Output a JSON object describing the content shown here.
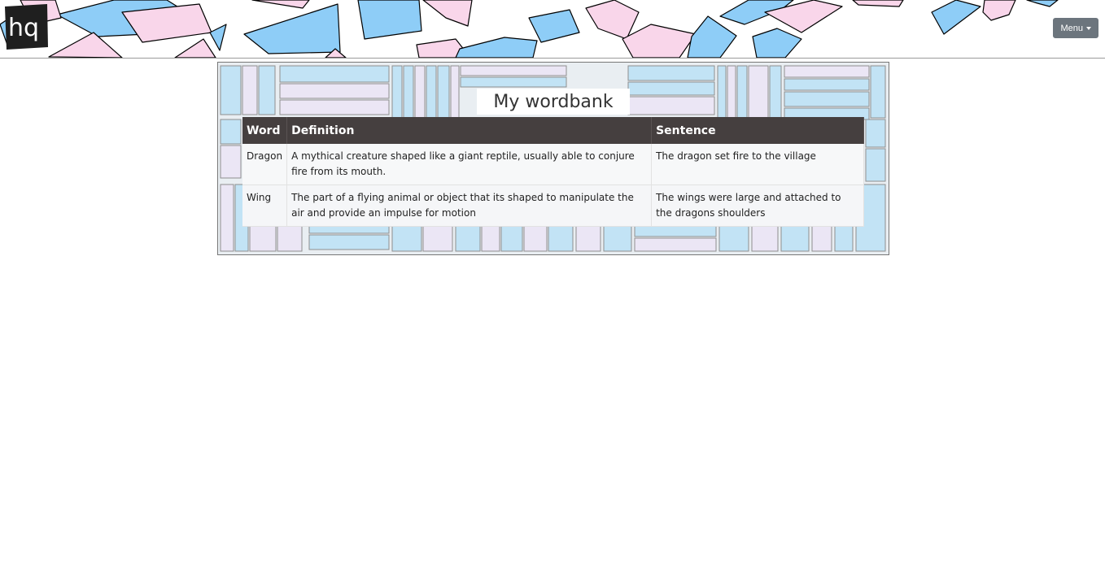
{
  "header": {
    "logo_text": "hq",
    "menu_label": "Menu"
  },
  "wordbank": {
    "title": "My wordbank",
    "columns": [
      "Word",
      "Definition",
      "Sentence"
    ],
    "rows": [
      {
        "word": "Dragon",
        "definition": "A mythical creature shaped like a giant reptile, usually able to conjure fire from its mouth.",
        "sentence": "The dragon set fire to the village"
      },
      {
        "word": "Wing",
        "definition": "The part of a flying animal or object that its shaped to manipulate the air and provide an impulse for motion",
        "sentence": "The wings were large and attached to the dragons shoulders"
      }
    ]
  },
  "colors": {
    "header_blue": "#8ecdf7",
    "header_pink": "#f9d6ea",
    "table_header": "#453f3f",
    "menu_button": "#6c757d"
  },
  "icons": [
    "hq-logo",
    "caret-down-icon"
  ]
}
